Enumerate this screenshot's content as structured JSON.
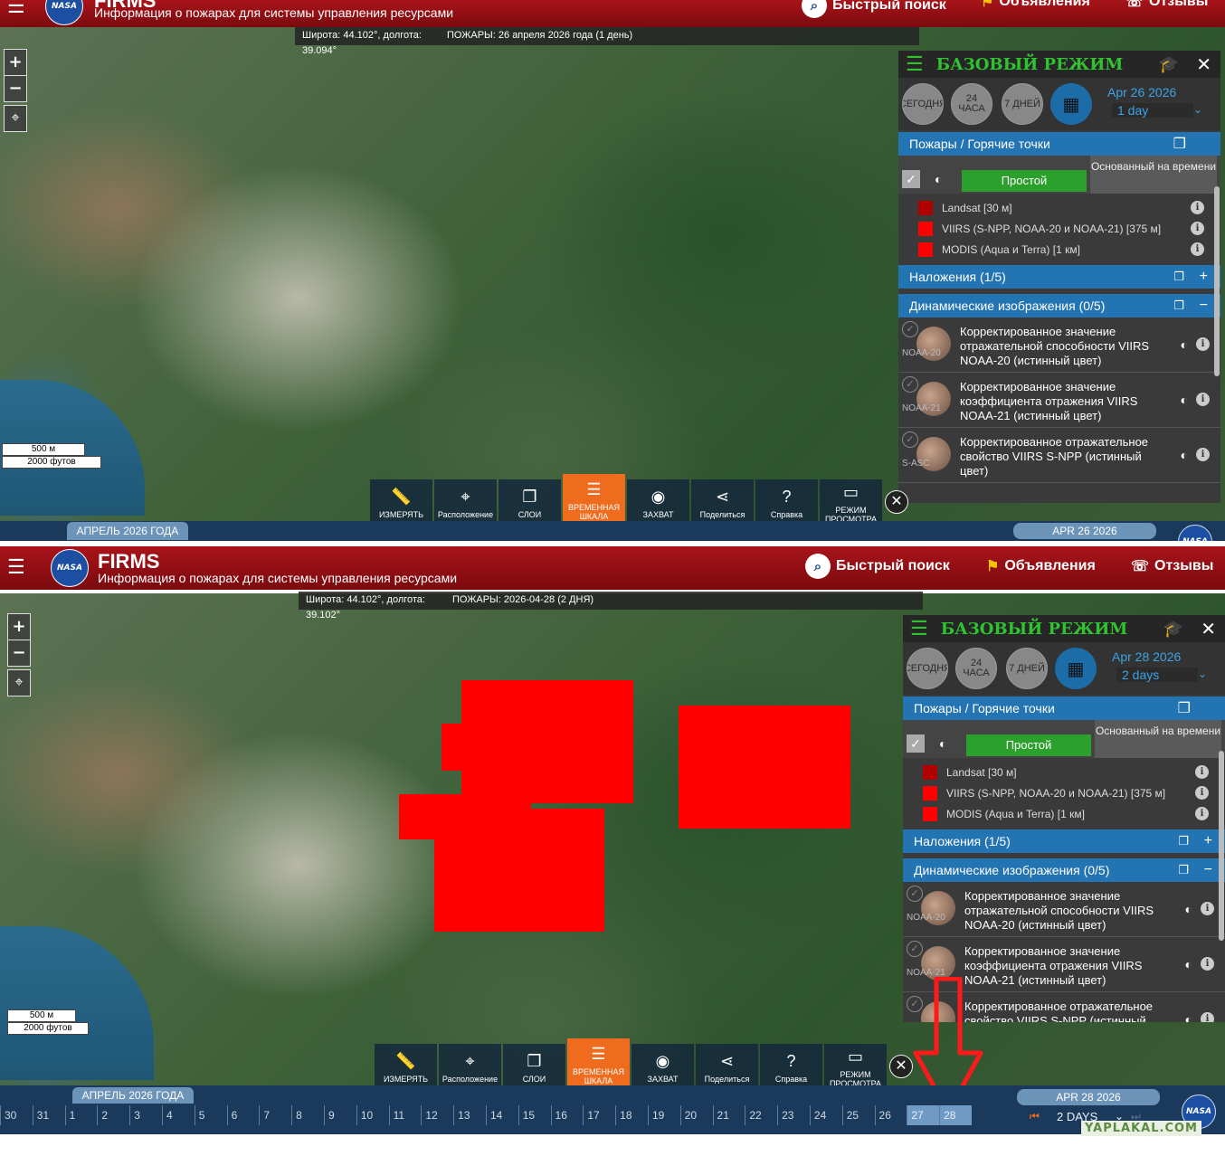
{
  "header": {
    "menu_icon": "hamburger-icon",
    "logo_text": "NASA",
    "title": "FIRMS",
    "subtitle": "Информация о пожарах для системы управления ресурсами",
    "quick_search": "Быстрый поиск",
    "announcements": "Объявления",
    "feedback": "Отзывы"
  },
  "shot_top": {
    "coords_lat": "Широта: 44.102°, долгота:",
    "coords_lon": "39.094°",
    "fires_label": "ПОЖАРЫ: 26 апреля 2026 года (1 день)",
    "date_display": "Apr 26 2026",
    "range_value": "1 day",
    "month_label": "АПРЕЛЬ 2026 ГОДА",
    "date_tab": "APR 26 2026"
  },
  "shot_bottom": {
    "coords_lat": "Широта: 44.102°, долгота:",
    "coords_lon": "39.102°",
    "fires_label": "ПОЖАРЫ: 2026-04-28 (2 ДНЯ)",
    "date_display": "Apr 28 2026",
    "range_value": "2 days",
    "month_label": "АПРЕЛЬ 2026 ГОДА",
    "date_tab": "APR 28 2026",
    "range_tab": "2 DAYS",
    "days": [
      "30",
      "31",
      "1",
      "2",
      "3",
      "4",
      "5",
      "6",
      "7",
      "8",
      "9",
      "10",
      "11",
      "12",
      "13",
      "14",
      "15",
      "16",
      "17",
      "18",
      "19",
      "20",
      "21",
      "22",
      "23",
      "24",
      "25",
      "26",
      "27",
      "28"
    ],
    "selected_days": [
      "27",
      "28"
    ]
  },
  "panel": {
    "title": "БАЗОВЫЙ РЕЖИМ",
    "today": "СЕГОДНЯ",
    "h24": "24 ЧАСА",
    "d7": "7 ДНЕЙ",
    "fires_section": "Пожары / Горячие точки",
    "tab_simple": "Простой",
    "tab_time": "Основанный на времени",
    "sources": [
      {
        "label": "Landsat [30 м]",
        "color": "#b00000"
      },
      {
        "label": "VIIRS (S-NPP, NOAA-20 и NOAA-21) [375 м]",
        "color": "#ff0000"
      },
      {
        "label": "MODIS (Aqua и Terra) [1 км]",
        "color": "#ff0000"
      }
    ],
    "overlays": "Наложения (1/5)",
    "dynamic": "Динамические изображения (0/5)",
    "dynamic_items": [
      {
        "tag": "NOAA-20",
        "label": "Корректированное значение отражательной способности VIIRS NOAA-20 (истинный цвет)"
      },
      {
        "tag": "NOAA-21",
        "label": "Корректированное значение коэффициента отражения VIIRS NOAA-21 (истинный цвет)"
      },
      {
        "tag": "S-ASC",
        "label": "Корректированное отражательное свойство VIIRS S-NPP (истинный цвет)"
      }
    ]
  },
  "scale": {
    "metric": "500 м",
    "imperial": "2000 футов"
  },
  "toolbar": {
    "measure": "ИЗМЕРЯТЬ",
    "location": "Расположение",
    "layers": "СЛОИ",
    "timeline": "ВРЕМЕННАЯ ШКАЛА",
    "capture": "ЗАХВАТ",
    "share": "Поделиться",
    "help": "Справка",
    "view": "РЕЖИМ ПРОСМОТРА"
  },
  "watermark": "YAPLAKAL.COM",
  "colors": {
    "header": "#9b1116",
    "accent_green": "#2fc42f",
    "section_blue": "#2374b3",
    "fire_red": "#ff0000",
    "timeline_active": "#ef6c1e"
  }
}
